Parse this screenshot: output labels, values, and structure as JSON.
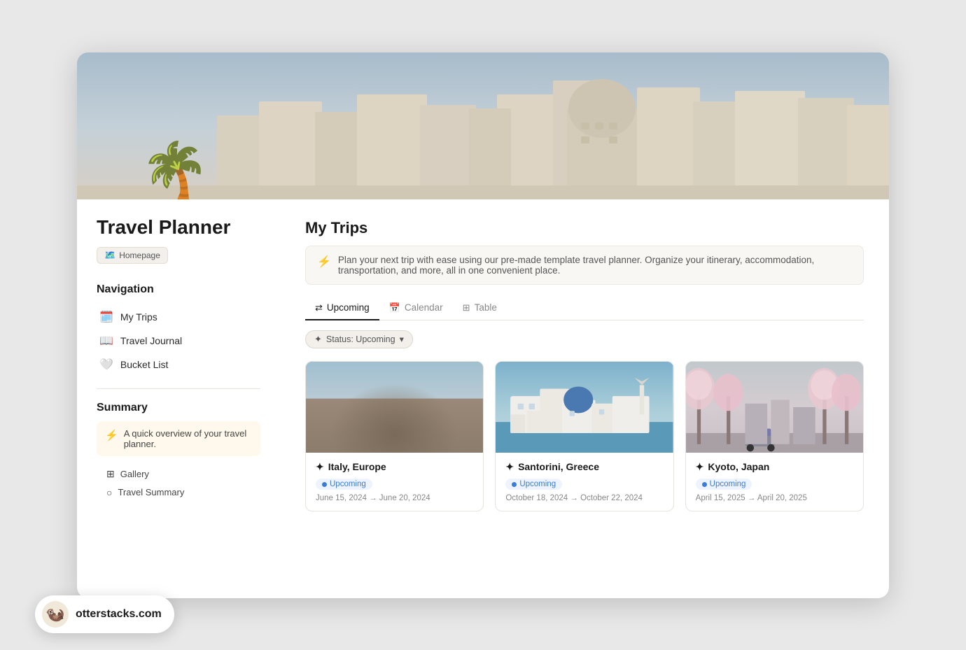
{
  "app": {
    "title": "Travel Planner",
    "icon": "🌴",
    "badge": "Homepage",
    "badge_icon": "🗺️"
  },
  "sidebar": {
    "navigation_heading": "Navigation",
    "nav_items": [
      {
        "label": "My Trips",
        "icon": "🗓️"
      },
      {
        "label": "Travel Journal",
        "icon": "📖"
      },
      {
        "label": "Bucket List",
        "icon": "🤍"
      }
    ],
    "summary_heading": "Summary",
    "summary_callout": "A quick overview of your travel planner.",
    "summary_callout_icon": "⚡",
    "sub_items": [
      {
        "label": "Gallery",
        "icon": "⊞"
      },
      {
        "label": "Travel Summary",
        "icon": "○"
      }
    ]
  },
  "main": {
    "title": "My Trips",
    "callout_icon": "⚡",
    "callout_text": "Plan your next trip with ease using our pre-made template travel planner. Organize your itinerary, accommodation, transportation, and more, all in one convenient place.",
    "tabs": [
      {
        "label": "Upcoming",
        "icon": "⇄",
        "active": true
      },
      {
        "label": "Calendar",
        "icon": "📅",
        "active": false
      },
      {
        "label": "Table",
        "icon": "⊞",
        "active": false
      }
    ],
    "filter_label": "Status: Upcoming",
    "filter_icon": "✦",
    "cards": [
      {
        "destination": "Italy, Europe",
        "icon": "✦",
        "status": "Upcoming",
        "dates": "June 15, 2024 → June 20, 2024",
        "img_type": "colosseum"
      },
      {
        "destination": "Santorini, Greece",
        "icon": "✦",
        "status": "Upcoming",
        "dates": "October 18, 2024 → October 22, 2024",
        "img_type": "santorini"
      },
      {
        "destination": "Kyoto, Japan",
        "icon": "✦",
        "status": "Upcoming",
        "dates": "April 15, 2025 → April 20, 2025",
        "img_type": "kyoto"
      }
    ]
  },
  "watermark": {
    "url": "otterstacks.com",
    "avatar_emoji": "🦦"
  }
}
